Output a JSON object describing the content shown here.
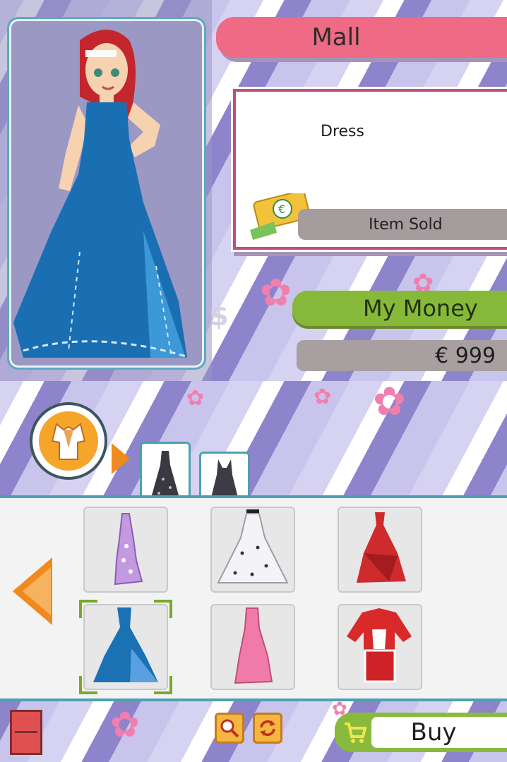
{
  "top": {
    "location_title": "Mall",
    "item": {
      "name": "Dress",
      "status": "Item  Sold"
    },
    "money": {
      "label": "My Money",
      "value": "€ 999"
    }
  },
  "bottom": {
    "category_icon": "outfit-category-icon",
    "tabs": [
      {
        "icon": "dark-dress-thumbnail-icon"
      },
      {
        "icon": "dark-gown-thumbnail-icon"
      }
    ],
    "items": [
      {
        "icon": "purple-sequin-dress-icon",
        "color": "#b98ad8"
      },
      {
        "icon": "white-polka-dot-gown-icon",
        "color": "#e8e8ee"
      },
      {
        "icon": "red-ruffle-dress-icon",
        "color": "#c8282b"
      },
      {
        "icon": "blue-ball-gown-icon",
        "color": "#1b73b6",
        "selected": true
      },
      {
        "icon": "pink-gown-icon",
        "color": "#f07aa6"
      },
      {
        "icon": "red-white-jacket-outfit-icon",
        "color": "#d42a2a"
      }
    ],
    "buy_label": "Buy"
  },
  "colors": {
    "banner_pink": "#ef6a85",
    "money_green": "#86b83a",
    "frame_teal": "#4ea0b0",
    "accent_orange": "#f08a1e"
  }
}
